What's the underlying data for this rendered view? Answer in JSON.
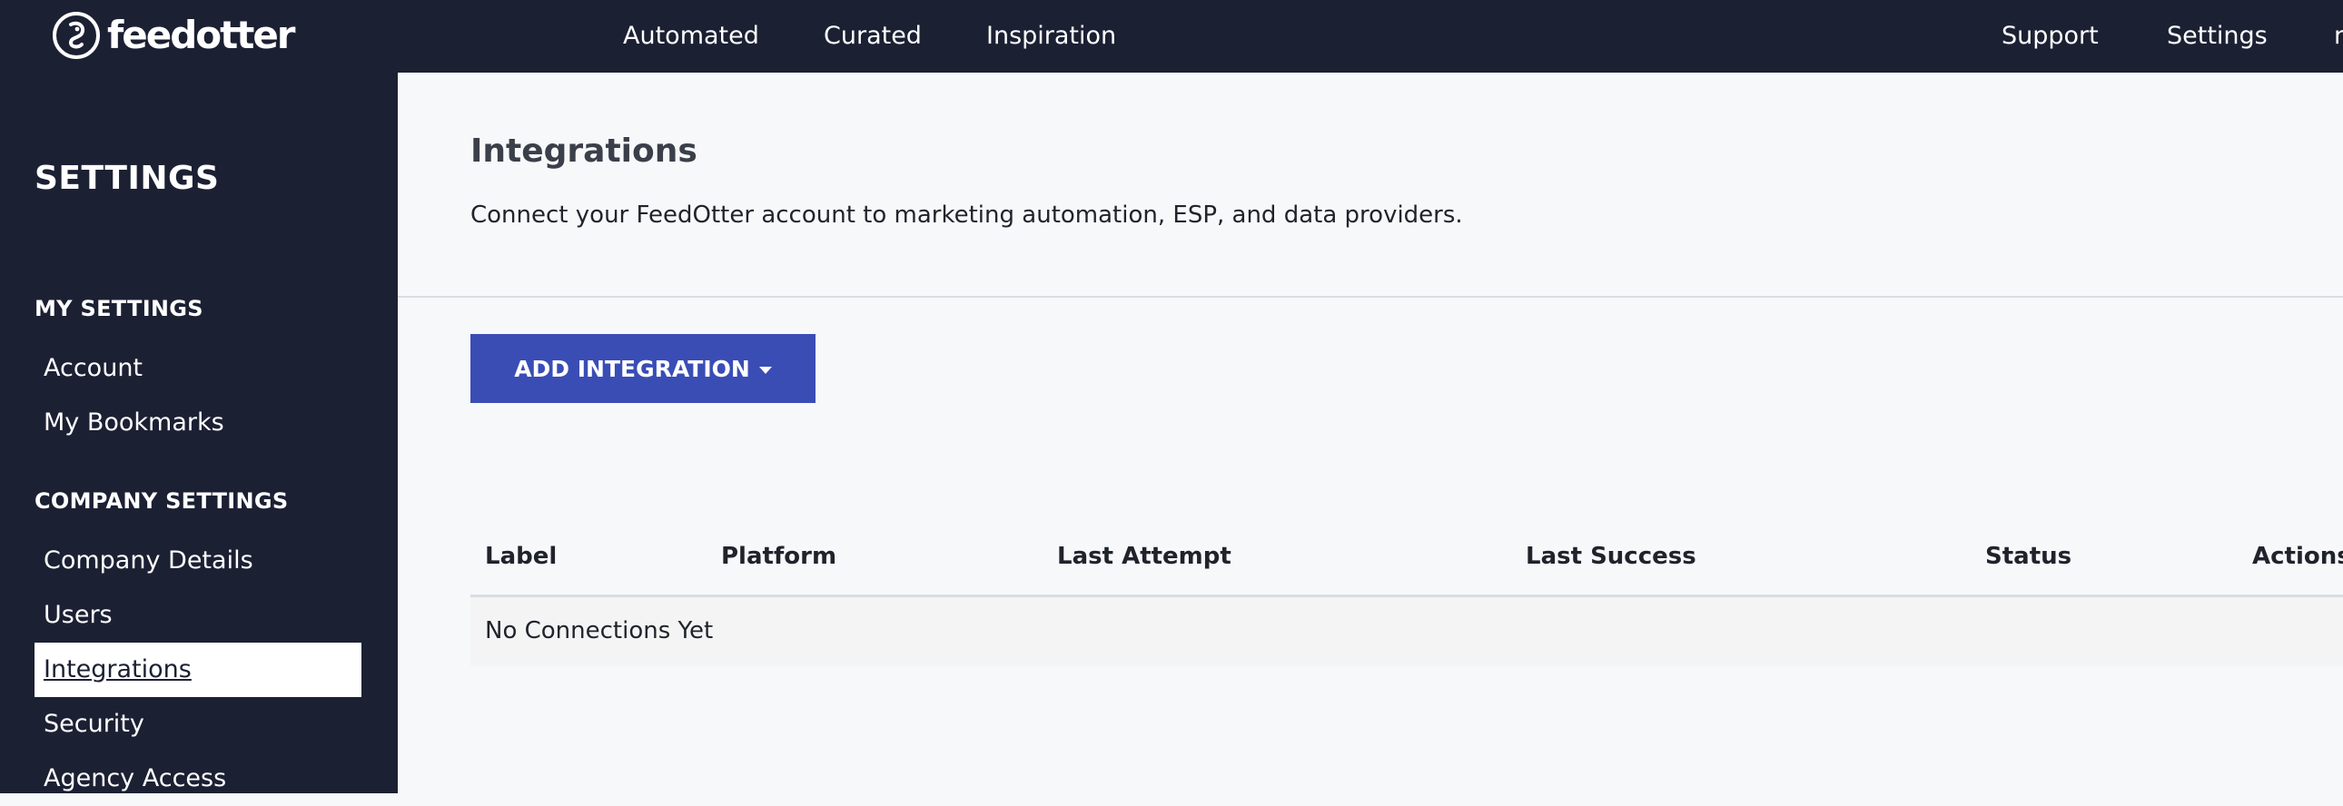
{
  "topbar": {
    "logo_text": "feedotter",
    "nav_left": [
      "Automated",
      "Curated",
      "Inspiration"
    ],
    "nav_right": [
      "Support",
      "Settings",
      "r"
    ]
  },
  "sidebar": {
    "title": "SETTINGS",
    "my_settings": {
      "heading": "MY SETTINGS",
      "items": [
        "Account",
        "My Bookmarks"
      ]
    },
    "company_settings": {
      "heading": "COMPANY SETTINGS",
      "items": [
        "Company Details",
        "Users",
        "Integrations",
        "Security",
        "Agency Access"
      ],
      "active": "Integrations"
    }
  },
  "main": {
    "title": "Integrations",
    "description": "Connect your FeedOtter account to marketing automation, ESP, and data providers.",
    "add_button": "ADD INTEGRATION",
    "table": {
      "headers": [
        "Label",
        "Platform",
        "Last Attempt",
        "Last Success",
        "Status",
        "Actions"
      ],
      "empty_message": "No Connections Yet"
    }
  },
  "colors": {
    "nav_bg": "#1c2033",
    "accent": "#3a4db5",
    "page_bg": "#f7f8fa"
  }
}
